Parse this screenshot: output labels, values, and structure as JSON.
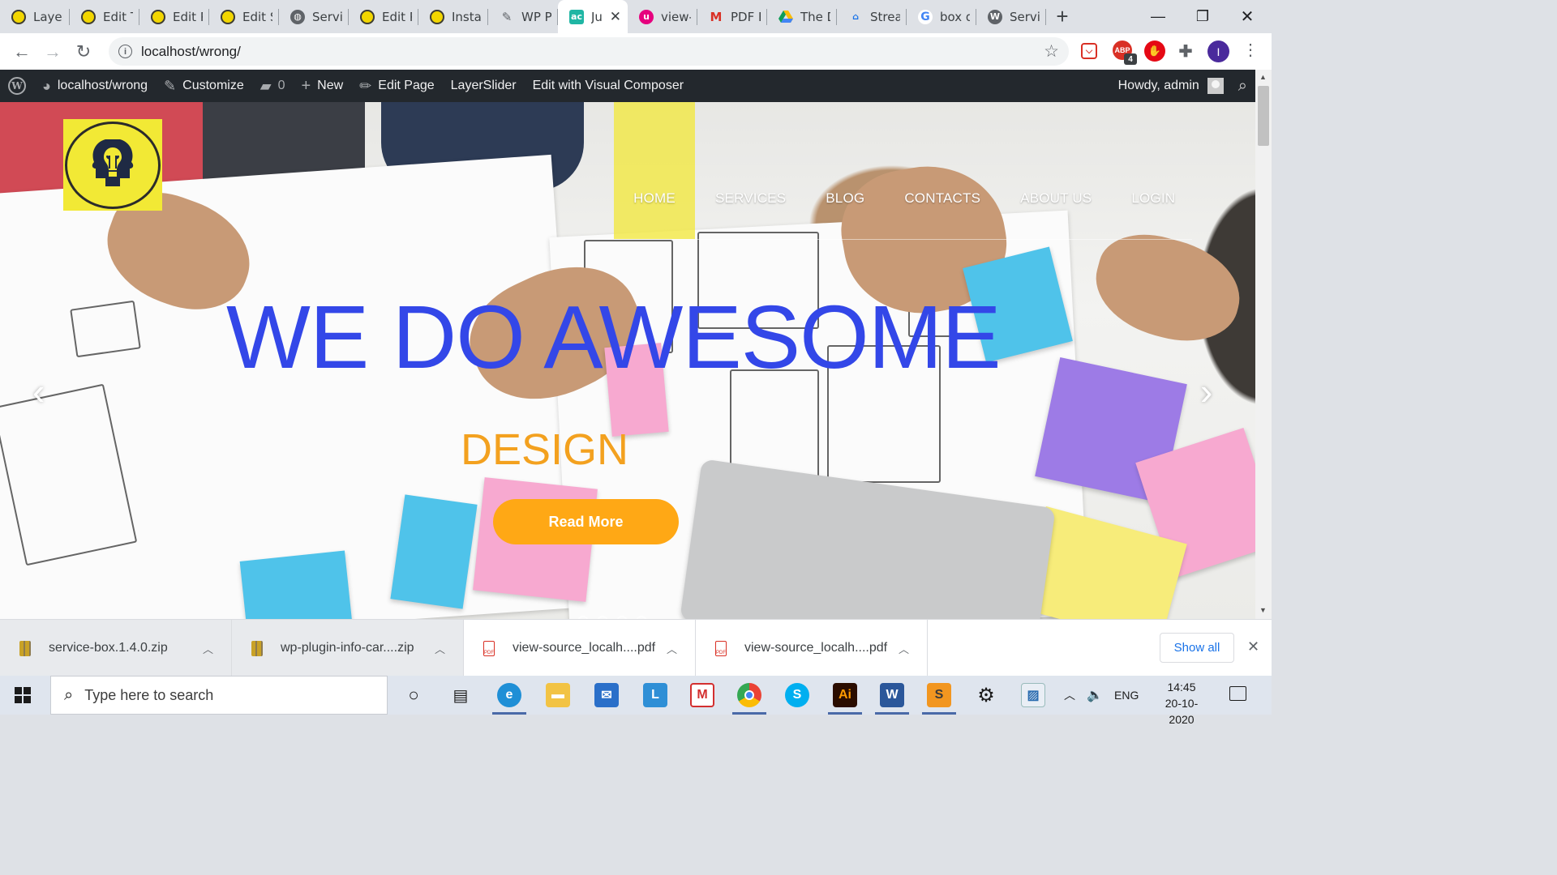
{
  "browser": {
    "tabs": [
      {
        "title": "Layer",
        "icon": "bulb-logo-icon"
      },
      {
        "title": "Edit T",
        "icon": "bulb-logo-icon"
      },
      {
        "title": "Edit P",
        "icon": "bulb-logo-icon"
      },
      {
        "title": "Edit S",
        "icon": "bulb-logo-icon"
      },
      {
        "title": "Servic",
        "icon": "globe-icon"
      },
      {
        "title": "Edit P",
        "icon": "bulb-logo-icon"
      },
      {
        "title": "Instal",
        "icon": "bulb-logo-icon"
      },
      {
        "title": "WP P",
        "icon": "feather-icon"
      },
      {
        "title": "Ju",
        "icon": "ac-icon",
        "active": true
      },
      {
        "title": "view-",
        "icon": "uc-icon"
      },
      {
        "title": "PDF F",
        "icon": "gmail-icon"
      },
      {
        "title": "The D",
        "icon": "drive-icon"
      },
      {
        "title": "Strear",
        "icon": "stream-icon"
      },
      {
        "title": "box d",
        "icon": "google-icon"
      },
      {
        "title": "Servic",
        "icon": "wordpress-icon"
      }
    ],
    "new_tab": "+",
    "url": "localhost/wrong/",
    "extensions": {
      "abp_badge": "4",
      "profile_initial": "I"
    }
  },
  "wp_admin_bar": {
    "site_name": "localhost/wrong",
    "customize": "Customize",
    "comments_count": "0",
    "new": "New",
    "edit_page": "Edit Page",
    "layerslider": "LayerSlider",
    "visual_composer": "Edit with Visual Composer",
    "howdy": "Howdy, admin"
  },
  "site": {
    "nav": [
      "HOME",
      "SERVICES",
      "BLOG",
      "CONTACTS",
      "ABOUT US",
      "LOGIN"
    ],
    "active_nav": "HOME",
    "headline": "WE DO AWESOME",
    "subheadline": "DESIGN",
    "cta": "Read More",
    "colors": {
      "headline": "#3347e8",
      "subheadline": "#f3a11f",
      "cta": "#ffa815",
      "nav_highlight": "#f1e846",
      "logo_bg": "#f2e935"
    }
  },
  "downloads": [
    {
      "name": "service-box.1.4.0.zip",
      "type": "zip"
    },
    {
      "name": "wp-plugin-info-car....zip",
      "type": "zip"
    },
    {
      "name": "view-source_localh....pdf",
      "type": "pdf"
    },
    {
      "name": "view-source_localh....pdf",
      "type": "pdf"
    }
  ],
  "downloads_show_all": "Show all",
  "taskbar": {
    "search_placeholder": "Type here to search",
    "language": "ENG",
    "time": "14:45",
    "date": "20-10-2020"
  }
}
